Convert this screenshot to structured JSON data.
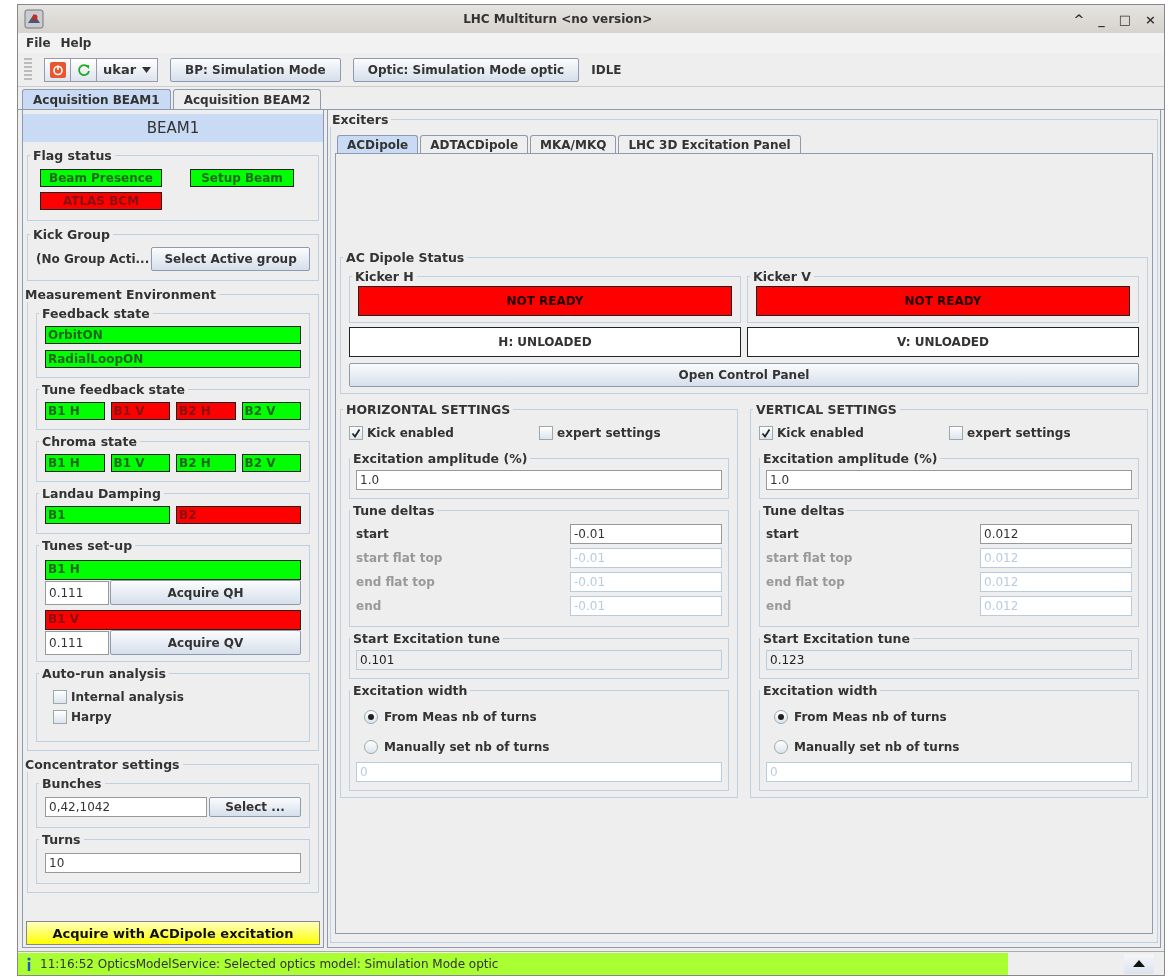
{
  "window": {
    "title": "LHC Multiturn <no version>",
    "controls": [
      "^",
      "_",
      "□",
      "×"
    ]
  },
  "menu": [
    "File",
    "Help"
  ],
  "toolbar": {
    "user": "ukar",
    "buttons": [
      "BP: Simulation Mode",
      "Optic: Simulation Mode optic"
    ],
    "status": "IDLE"
  },
  "tabs": [
    {
      "label": "Acquisition BEAM1",
      "selected": true
    },
    {
      "label": "Acquisition BEAM2",
      "selected": false
    }
  ],
  "left": {
    "title": "BEAM1",
    "flag_status": {
      "title": "Flag status",
      "flags": [
        {
          "label": "Beam Presence",
          "on": true
        },
        {
          "label": "Setup Beam",
          "on": true
        },
        {
          "label": "ATLAS BCM",
          "on": false
        }
      ]
    },
    "kick_group": {
      "title": "Kick Group",
      "value": "(No Group Acti...",
      "button": "Select Active group"
    },
    "measurement": {
      "title": "Measurement Environment",
      "feedback": {
        "title": "Feedback state",
        "items": [
          {
            "label": "OrbitON",
            "on": true
          },
          {
            "label": "RadialLoopON",
            "on": true
          }
        ]
      },
      "tune_feedback": {
        "title": "Tune feedback state",
        "items": [
          {
            "label": "B1 H",
            "on": true
          },
          {
            "label": "B1 V",
            "on": false
          },
          {
            "label": "B2 H",
            "on": false
          },
          {
            "label": "B2 V",
            "on": true
          }
        ]
      },
      "chroma": {
        "title": "Chroma state",
        "items": [
          {
            "label": "B1 H",
            "on": true
          },
          {
            "label": "B1 V",
            "on": true
          },
          {
            "label": "B2 H",
            "on": true
          },
          {
            "label": "B2 V",
            "on": true
          }
        ]
      },
      "landau": {
        "title": "Landau Damping",
        "items": [
          {
            "label": "B1",
            "on": true
          },
          {
            "label": "B2",
            "on": false
          }
        ]
      },
      "tunes": {
        "title": "Tunes set-up",
        "rows": [
          {
            "label": "B1 H",
            "on": true,
            "value": "0.111",
            "button": "Acquire QH"
          },
          {
            "label": "B1 V",
            "on": false,
            "value": "0.111",
            "button": "Acquire QV"
          }
        ]
      },
      "auto_run": {
        "title": "Auto-run analysis",
        "options": [
          {
            "label": "Internal analysis",
            "checked": false
          },
          {
            "label": "Harpy",
            "checked": false
          }
        ]
      }
    },
    "concentrator": {
      "title": "Concentrator settings",
      "bunches": {
        "title": "Bunches",
        "value": "0,42,1042",
        "button": "Select ..."
      },
      "turns": {
        "title": "Turns",
        "value": "10"
      }
    },
    "acquire_button": "Acquire with ACDipole excitation"
  },
  "exciters": {
    "title": "Exciters",
    "tabs": [
      {
        "label": "ACDipole",
        "selected": true
      },
      {
        "label": "ADTACDipole",
        "selected": false
      },
      {
        "label": "MKA/MKQ",
        "selected": false
      },
      {
        "label": "LHC 3D Excitation Panel",
        "selected": false
      }
    ],
    "status": {
      "title": "AC Dipole Status",
      "kickers": [
        {
          "title": "Kicker H",
          "state": "NOT READY",
          "ready": false,
          "load": "H: UNLOADED"
        },
        {
          "title": "Kicker V",
          "state": "NOT READY",
          "ready": false,
          "load": "V: UNLOADED"
        }
      ],
      "button": "Open Control Panel"
    },
    "settings": [
      {
        "title": "HORIZONTAL SETTINGS",
        "kick": {
          "label": "Kick enabled",
          "checked": true
        },
        "expert": {
          "label": "expert settings",
          "checked": false
        },
        "amplitude": {
          "title": "Excitation amplitude (%)",
          "value": "1.0"
        },
        "tune_deltas": {
          "title": "Tune deltas",
          "rows": [
            {
              "label": "start",
              "value": "-0.01",
              "disabled": false
            },
            {
              "label": "start flat top",
              "value": "-0.01",
              "disabled": true
            },
            {
              "label": "end flat top",
              "value": "-0.01",
              "disabled": true
            },
            {
              "label": "end",
              "value": "-0.01",
              "disabled": true
            }
          ]
        },
        "start_tune": {
          "title": "Start Excitation tune",
          "value": "0.101"
        },
        "width": {
          "title": "Excitation width",
          "options": [
            {
              "label": "From Meas nb of turns",
              "selected": true
            },
            {
              "label": "Manually set nb of turns",
              "selected": false
            }
          ],
          "value": "0"
        }
      },
      {
        "title": "VERTICAL SETTINGS",
        "kick": {
          "label": "Kick enabled",
          "checked": true
        },
        "expert": {
          "label": "expert settings",
          "checked": false
        },
        "amplitude": {
          "title": "Excitation amplitude (%)",
          "value": "1.0"
        },
        "tune_deltas": {
          "title": "Tune deltas",
          "rows": [
            {
              "label": "start",
              "value": "0.012",
              "disabled": false
            },
            {
              "label": "start flat top",
              "value": "0.012",
              "disabled": true
            },
            {
              "label": "end flat top",
              "value": "0.012",
              "disabled": true
            },
            {
              "label": "end",
              "value": "0.012",
              "disabled": true
            }
          ]
        },
        "start_tune": {
          "title": "Start Excitation tune",
          "value": "0.123"
        },
        "width": {
          "title": "Excitation width",
          "options": [
            {
              "label": "From Meas nb of turns",
              "selected": true
            },
            {
              "label": "Manually set nb of turns",
              "selected": false
            }
          ],
          "value": "0"
        }
      }
    ]
  },
  "status_bar": {
    "message": "11:16:52 OpticsModelService: Selected optics model: Simulation Mode optic"
  }
}
